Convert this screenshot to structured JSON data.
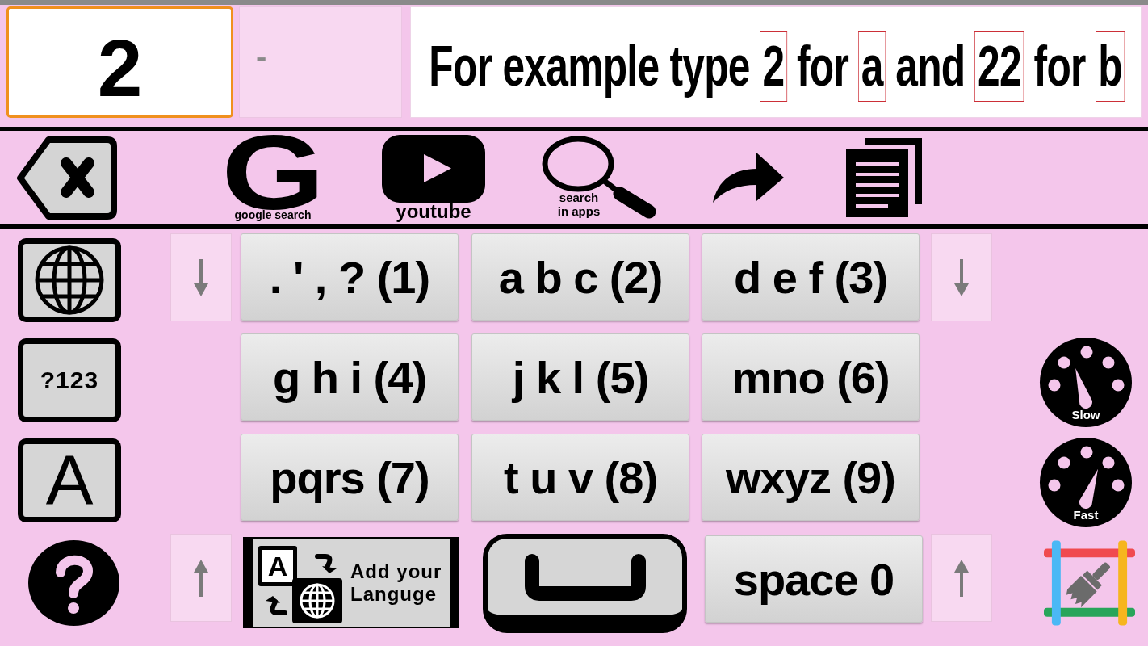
{
  "input": {
    "value": "2",
    "focused": true
  },
  "preview": {
    "value": "-"
  },
  "hint": [
    {
      "text": "For example type",
      "boxed": false
    },
    {
      "text": "2",
      "boxed": true
    },
    {
      "text": "for",
      "boxed": false
    },
    {
      "text": "a",
      "boxed": true
    },
    {
      "text": "and",
      "boxed": false
    },
    {
      "text": "22",
      "boxed": true
    },
    {
      "text": "for",
      "boxed": false
    },
    {
      "text": "b",
      "boxed": true
    }
  ],
  "toolbar": [
    {
      "kind": "backspace"
    },
    {
      "kind": "google",
      "logo": "G",
      "label": "google search"
    },
    {
      "kind": "youtube",
      "label": "youtube"
    },
    {
      "kind": "search",
      "label": "search in apps"
    },
    {
      "kind": "share"
    },
    {
      "kind": "copy"
    }
  ],
  "side_keys": [
    {
      "kind": "globe"
    },
    {
      "kind": "symbols",
      "label": "?123"
    },
    {
      "kind": "letter",
      "label": "A"
    },
    {
      "kind": "help"
    }
  ],
  "scroll_arrows": {
    "left": [
      {
        "kind": "down"
      },
      {
        "kind": "up"
      }
    ],
    "right": [
      {
        "kind": "down"
      },
      {
        "kind": "up"
      }
    ]
  },
  "keys": [
    {
      "label": ". ' , ? (1)"
    },
    {
      "label": "a b c (2)"
    },
    {
      "label": "d e f (3)"
    },
    {
      "label": "g h i (4)"
    },
    {
      "label": "j k l (5)"
    },
    {
      "label": "mno (6)"
    },
    {
      "label": "pqrs (7)"
    },
    {
      "label": "t u v (8)"
    },
    {
      "label": "wxyz (9)"
    }
  ],
  "bottom_keys": [
    {
      "kind": "add_language",
      "icon_letter": "A",
      "label": "Add your Languge"
    },
    {
      "kind": "space_bar"
    },
    {
      "kind": "key",
      "label": "space 0"
    }
  ],
  "speed_buttons": [
    {
      "kind": "slow",
      "label": "Slow"
    },
    {
      "kind": "fast",
      "label": "Fast"
    }
  ]
}
